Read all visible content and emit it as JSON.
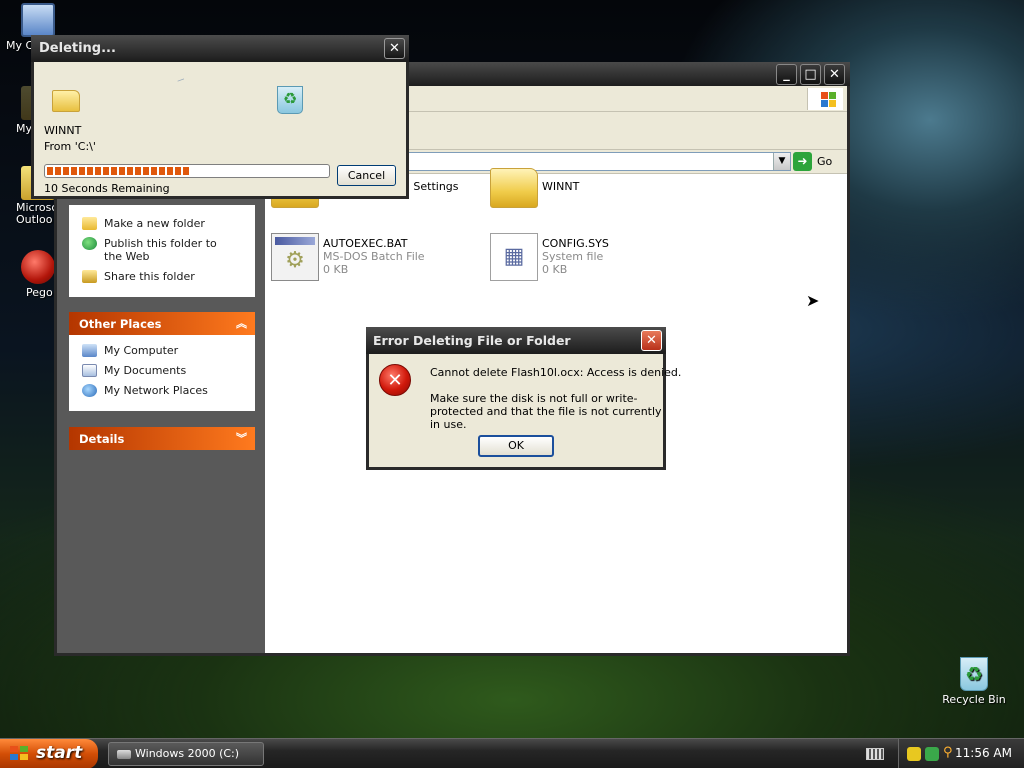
{
  "desktop": {
    "icons": [
      {
        "label": "My C"
      },
      {
        "label": "My"
      },
      {
        "label": "Microsc Outloo"
      },
      {
        "label": "Pego"
      }
    ],
    "recycle_bin": "Recycle Bin"
  },
  "explorer": {
    "address_go": "Go",
    "taskpane": {
      "file_tasks": [
        {
          "label": "Make a new folder",
          "icon": "new-folder-icon"
        },
        {
          "label": "Publish this folder to the Web",
          "icon": "globe-icon"
        },
        {
          "label": "Share this folder",
          "icon": "share-folder-icon"
        }
      ],
      "other_places_title": "Other Places",
      "other_places": [
        {
          "label": "My Computer",
          "icon": "computer-icon"
        },
        {
          "label": "My Documents",
          "icon": "documents-icon"
        },
        {
          "label": "My Network Places",
          "icon": "network-icon"
        }
      ],
      "details_title": "Details"
    },
    "files": [
      {
        "name": "Documents and Settings",
        "type": "",
        "size": ""
      },
      {
        "name": "WINNT",
        "type": "",
        "size": ""
      },
      {
        "name": "AUTOEXEC.BAT",
        "type": "MS-DOS Batch File",
        "size": "0 KB"
      },
      {
        "name": "CONFIG.SYS",
        "type": "System file",
        "size": "0 KB"
      }
    ]
  },
  "progress_dialog": {
    "title": "Deleting...",
    "item_name": "WINNT",
    "from": "From 'C:\\'",
    "progress": 0.5,
    "remaining": "10 Seconds Remaining",
    "cancel_label": "Cancel"
  },
  "error_dialog": {
    "title": "Error Deleting File or Folder",
    "message": "Cannot delete Flash10l.ocx: Access is denied.",
    "detail": "Make sure the disk is not full or write-protected and that the file is not currently in use.",
    "ok_label": "OK"
  },
  "taskbar": {
    "start_label": "start",
    "task": "Windows 2000 (C:)",
    "clock": "11:56 AM"
  },
  "colors": {
    "taskpane_header": "#e0580c",
    "progress_fill": "#e0580c",
    "error_close": "#c8401e"
  }
}
